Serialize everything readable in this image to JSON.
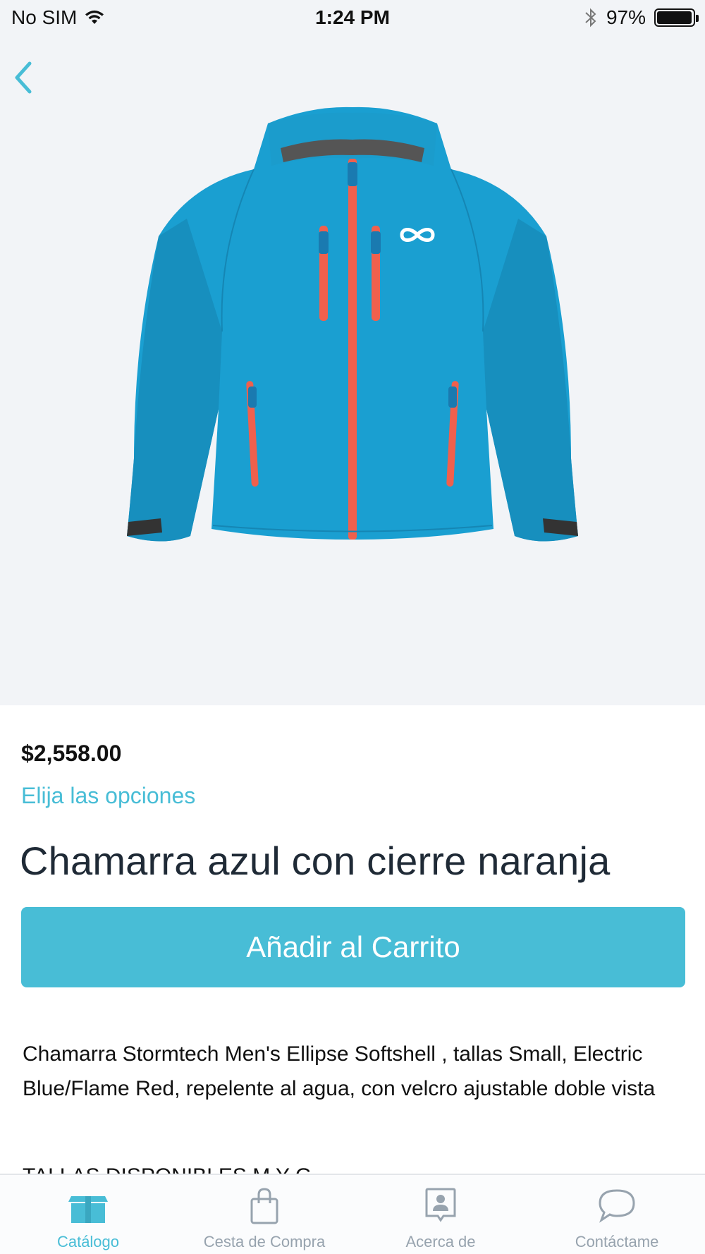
{
  "status_bar": {
    "carrier": "No SIM",
    "time": "1:24 PM",
    "battery": "97%",
    "battery_level": 0.97
  },
  "product": {
    "price": "$2,558.00",
    "options_link": "Elija las opciones",
    "title": "Chamarra azul con cierre naranja",
    "add_to_cart": "Añadir al Carrito",
    "description": "Chamarra Stormtech Men's Ellipse Softshell , tallas Small, Electric Blue/Flame Red, repelente al agua, con velcro ajustable doble vista",
    "sizes_text": "TALLAS DISPONIBLES M Y G"
  },
  "colors": {
    "accent": "#48bdd6",
    "jacket_blue": "#1a9fd1",
    "zipper_red": "#f0604d",
    "hero_bg": "#f2f4f7",
    "tab_inactive": "#97a3ae"
  },
  "tabs": [
    {
      "label": "Catálogo",
      "icon": "box-icon",
      "active": true
    },
    {
      "label": "Cesta de Compra",
      "icon": "shopping-bag-icon",
      "active": false
    },
    {
      "label": "Acerca de",
      "icon": "profile-card-icon",
      "active": false
    },
    {
      "label": "Contáctame",
      "icon": "chat-bubble-icon",
      "active": false
    }
  ]
}
